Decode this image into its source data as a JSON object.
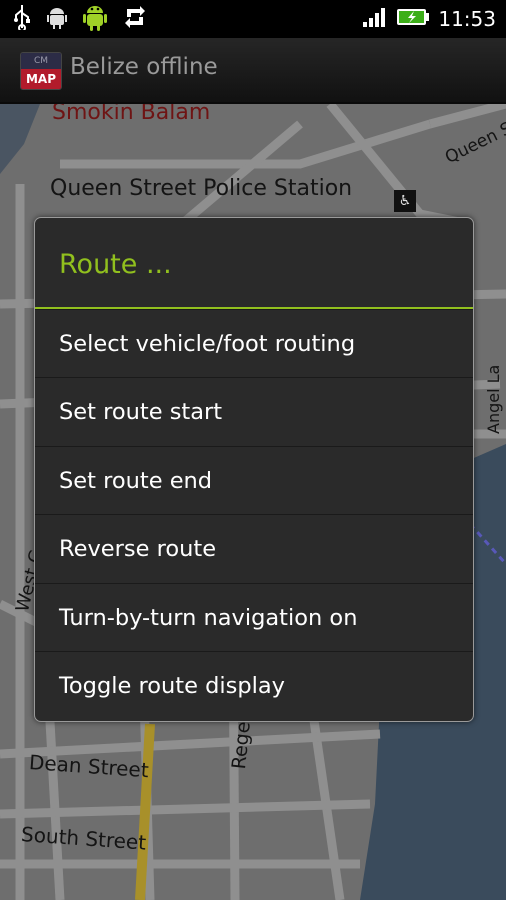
{
  "status_bar": {
    "time": "11:53",
    "icons": [
      "usb-icon",
      "android-debug-icon",
      "android-icon",
      "sync-icon",
      "signal-icon",
      "battery-icon"
    ]
  },
  "title_bar": {
    "app_title": "Belize offline",
    "app_icon": {
      "top_text": "CM",
      "bottom_text": "MAP"
    }
  },
  "map": {
    "labels": {
      "smokin_balam": "Smokin Balam",
      "queen_st_top": "Queen St",
      "police_station": "Queen Street Police Station",
      "angel_la": "Angel La",
      "west": "West C",
      "dean_street": "Dean Street",
      "south_street": "South Street",
      "rege": "Rege"
    }
  },
  "dialog": {
    "title": "Route ...",
    "items": [
      "Select vehicle/foot routing",
      "Set route start",
      "Set route end",
      "Reverse route",
      "Turn-by-turn navigation on",
      "Toggle route display"
    ]
  },
  "colors": {
    "accent": "#91c01e",
    "dialog_bg": "#2a2a2a",
    "dialog_border": "#9a9a9a",
    "water": "#3a4b5c",
    "map_land": "#6e6e6e"
  }
}
